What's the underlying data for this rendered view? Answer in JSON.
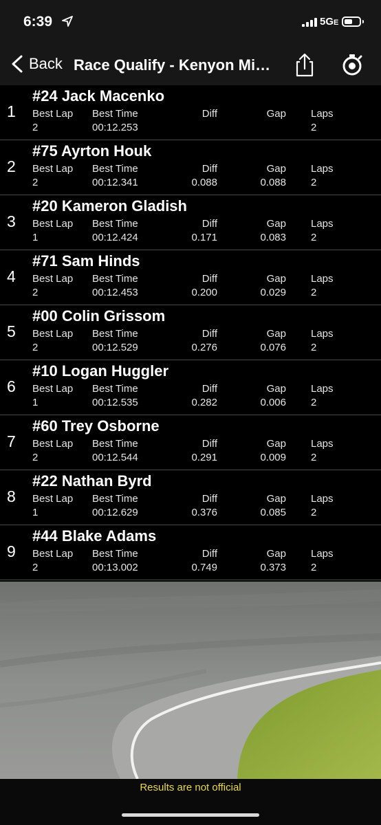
{
  "status_bar": {
    "time": "6:39",
    "network": "5G",
    "network_suffix": "E"
  },
  "nav": {
    "back_label": "Back",
    "title": "Race Qualify - Kenyon Midget Speedway",
    "icons": [
      "share-icon",
      "stopwatch-icon"
    ]
  },
  "columns": {
    "best_lap": "Best Lap",
    "best_time": "Best Time",
    "diff": "Diff",
    "gap": "Gap",
    "laps": "Laps"
  },
  "results": [
    {
      "pos": "1",
      "driver": "#24 Jack Macenko",
      "best_lap": "2",
      "best_time": "00:12.253",
      "diff": "",
      "gap": "",
      "laps": "2"
    },
    {
      "pos": "2",
      "driver": "#75 Ayrton Houk",
      "best_lap": "2",
      "best_time": "00:12.341",
      "diff": "0.088",
      "gap": "0.088",
      "laps": "2"
    },
    {
      "pos": "3",
      "driver": "#20 Kameron Gladish",
      "best_lap": "1",
      "best_time": "00:12.424",
      "diff": "0.171",
      "gap": "0.083",
      "laps": "2"
    },
    {
      "pos": "4",
      "driver": "#71 Sam Hinds",
      "best_lap": "2",
      "best_time": "00:12.453",
      "diff": "0.200",
      "gap": "0.029",
      "laps": "2"
    },
    {
      "pos": "5",
      "driver": "#00 Colin Grissom",
      "best_lap": "2",
      "best_time": "00:12.529",
      "diff": "0.276",
      "gap": "0.076",
      "laps": "2"
    },
    {
      "pos": "6",
      "driver": "#10 Logan Huggler",
      "best_lap": "1",
      "best_time": "00:12.535",
      "diff": "0.282",
      "gap": "0.006",
      "laps": "2"
    },
    {
      "pos": "7",
      "driver": "#60 Trey Osborne",
      "best_lap": "2",
      "best_time": "00:12.544",
      "diff": "0.291",
      "gap": "0.009",
      "laps": "2"
    },
    {
      "pos": "8",
      "driver": "#22 Nathan Byrd",
      "best_lap": "1",
      "best_time": "00:12.629",
      "diff": "0.376",
      "gap": "0.085",
      "laps": "2"
    },
    {
      "pos": "9",
      "driver": "#44 Blake Adams",
      "best_lap": "2",
      "best_time": "00:13.002",
      "diff": "0.749",
      "gap": "0.373",
      "laps": "2"
    }
  ],
  "footer": {
    "note": "Results are not official"
  },
  "colors": {
    "background": "#000000",
    "bar": "#171717",
    "footer_note": "#e8d84a",
    "track_asphalt": "#8a8c8a",
    "infield_grass": "#8fa63a"
  }
}
